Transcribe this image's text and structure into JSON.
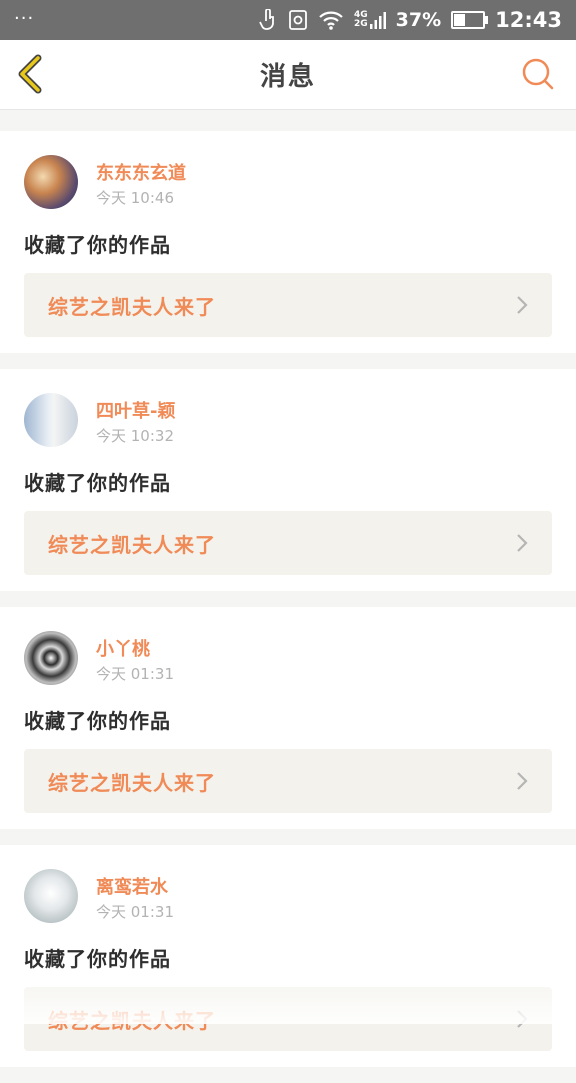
{
  "status_bar": {
    "network_label": "4G\n2G",
    "battery_percent": "37%",
    "battery_level": 0.37,
    "clock": "12:43"
  },
  "header": {
    "title": "消息",
    "back_icon": "chevron-left-icon",
    "search_icon": "search-icon"
  },
  "colors": {
    "accent": "#f08a57",
    "back_icon": "#d6b400"
  },
  "messages": [
    {
      "username": "东东东玄道",
      "time": "今天 10:46",
      "action": "收藏了你的作品",
      "work_title": "综艺之凯夫人来了"
    },
    {
      "username": "四叶草-颖",
      "time": "今天 10:32",
      "action": "收藏了你的作品",
      "work_title": "综艺之凯夫人来了"
    },
    {
      "username": "小丫桃",
      "time": "今天 01:31",
      "action": "收藏了你的作品",
      "work_title": "综艺之凯夫人来了"
    },
    {
      "username": "离鸾若水",
      "time": "今天 01:31",
      "action": "收藏了你的作品",
      "work_title": "综艺之凯夫人来了"
    }
  ]
}
